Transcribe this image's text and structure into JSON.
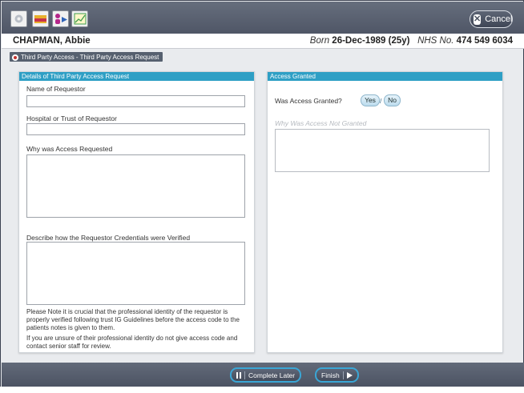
{
  "toolbar": {
    "icons": [
      "settings-icon",
      "folder-icon",
      "person-arrow-icon",
      "chart-icon"
    ],
    "cancel_label": "Cancel"
  },
  "patient": {
    "name": "CHAPMAN, Abbie",
    "born_label": "Born",
    "born_value": "26-Dec-1989 (25y)",
    "nhs_label": "NHS No.",
    "nhs_value": "474 549 6034"
  },
  "breadcrumb": "Third Party Access - Third Party Access Request",
  "left_panel": {
    "title": "Details of Third Party Access Request",
    "name_label": "Name of Requestor",
    "name_value": "",
    "hospital_label": "Hospital or Trust of Requestor",
    "hospital_value": "",
    "why_label": "Why was Access Requested",
    "why_value": "",
    "describe_label": "Describe how the Requestor Credentials were Verified",
    "describe_value": "",
    "note1": "Please Note it is crucial that the professional identity of the requestor is properly verified following trust IG Guidelines before the access code to the patients notes is given to them.",
    "note2": "If you are unsure of their professional identity do not give access code and contact senior staff for review."
  },
  "right_panel": {
    "title": "Access Granted",
    "question_label": "Was Access Granted?",
    "yes_label": "Yes",
    "slash": "/",
    "no_label": "No",
    "why_not_placeholder": "Why Was Access Not Granted",
    "why_not_value": ""
  },
  "footer": {
    "complete_later_label": "Complete Later",
    "finish_label": "Finish"
  },
  "colors": {
    "accent": "#2e9fc5",
    "toolbar": "#585f6f",
    "footer_button_border": "#3aa6d6"
  }
}
